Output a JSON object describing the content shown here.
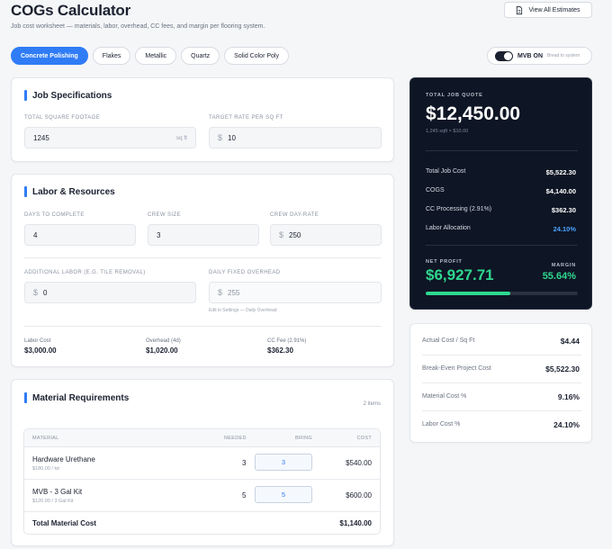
{
  "header": {
    "title": "COGs Calculator",
    "subtitle": "Job cost worksheet — materials, labor, overhead, CC fees, and margin per flooring system.",
    "view_all_label": "View All Estimates"
  },
  "tabs": [
    {
      "label": "Concrete Polishing",
      "active": true
    },
    {
      "label": "Flakes",
      "active": false
    },
    {
      "label": "Metallic",
      "active": false
    },
    {
      "label": "Quartz",
      "active": false
    },
    {
      "label": "Solid Color Poly",
      "active": false
    }
  ],
  "mvb_toggle": {
    "label": "MVB ON",
    "hint": "Bread to system",
    "on": true
  },
  "job_specs": {
    "title": "Job Specifications",
    "sqft_label": "Total Square Footage",
    "sqft_value": "1245",
    "sqft_suffix": "sq ft",
    "rate_label": "Target Rate Per Sq Ft",
    "rate_prefix": "$",
    "rate_value": "10"
  },
  "labor": {
    "title": "Labor & Resources",
    "days_label": "Days to Complete",
    "days_value": "4",
    "crew_label": "Crew Size",
    "crew_value": "3",
    "dayrate_label": "Crew Day-Rate",
    "dayrate_prefix": "$",
    "dayrate_value": "250",
    "additional_label": "Additional Labor (e.g. Tile Removal)",
    "additional_prefix": "$",
    "additional_value": "0",
    "overhead_label": "Daily Fixed Overhead",
    "overhead_prefix": "$",
    "overhead_value": "255",
    "overhead_hint": "Edit in Settings — Daily Overhead",
    "summary": [
      {
        "label": "Labor Cost",
        "value": "$3,000.00"
      },
      {
        "label": "Overhead (4d)",
        "value": "$1,020.00"
      },
      {
        "label": "CC Fee (2.91%)",
        "value": "$362.30"
      }
    ]
  },
  "materials": {
    "title": "Material Requirements",
    "count": "2 items",
    "headers": {
      "material": "MATERIAL",
      "needed": "NEEDED",
      "bring": "BRING",
      "cost": "COST"
    },
    "rows": [
      {
        "name": "Hardware Urethane",
        "price": "$180.00 / kit",
        "needed": "3",
        "bring": "3",
        "cost": "$540.00"
      },
      {
        "name": "MVB - 3 Gal Kit",
        "price": "$120.00 / 3 Gal Kit",
        "needed": "5",
        "bring": "5",
        "cost": "$600.00"
      }
    ],
    "total_label": "Total Material Cost",
    "total_value": "$1,140.00"
  },
  "quote": {
    "label": "TOTAL JOB QUOTE",
    "amount": "$12,450.00",
    "sub": "1,245 sqft × $10.00",
    "rows": [
      {
        "label": "Total Job Cost",
        "value": "$5,522.30",
        "accent": false
      },
      {
        "label": "COGS",
        "value": "$4,140.00",
        "accent": false
      },
      {
        "label": "CC Processing (2.91%)",
        "value": "$362.30",
        "accent": false
      },
      {
        "label": "Labor Allocation",
        "value": "24.10%",
        "accent": true
      }
    ],
    "profit_label": "NET PROFIT",
    "profit_value": "$6,927.71",
    "margin_label": "MARGIN",
    "margin_value": "55.64%",
    "margin_fraction": 0.5564
  },
  "stats": [
    {
      "label": "Actual Cost / Sq Ft",
      "value": "$4.44"
    },
    {
      "label": "Break-Even Project Cost",
      "value": "$5,522.30"
    },
    {
      "label": "Material Cost %",
      "value": "9.16%"
    },
    {
      "label": "Labor Cost %",
      "value": "24.10%"
    }
  ],
  "colors": {
    "accent": "#2f7cf6",
    "profit": "#2fd78f",
    "dark_panel": "#0e1524"
  },
  "icons": {
    "view_all": "document-icon"
  }
}
